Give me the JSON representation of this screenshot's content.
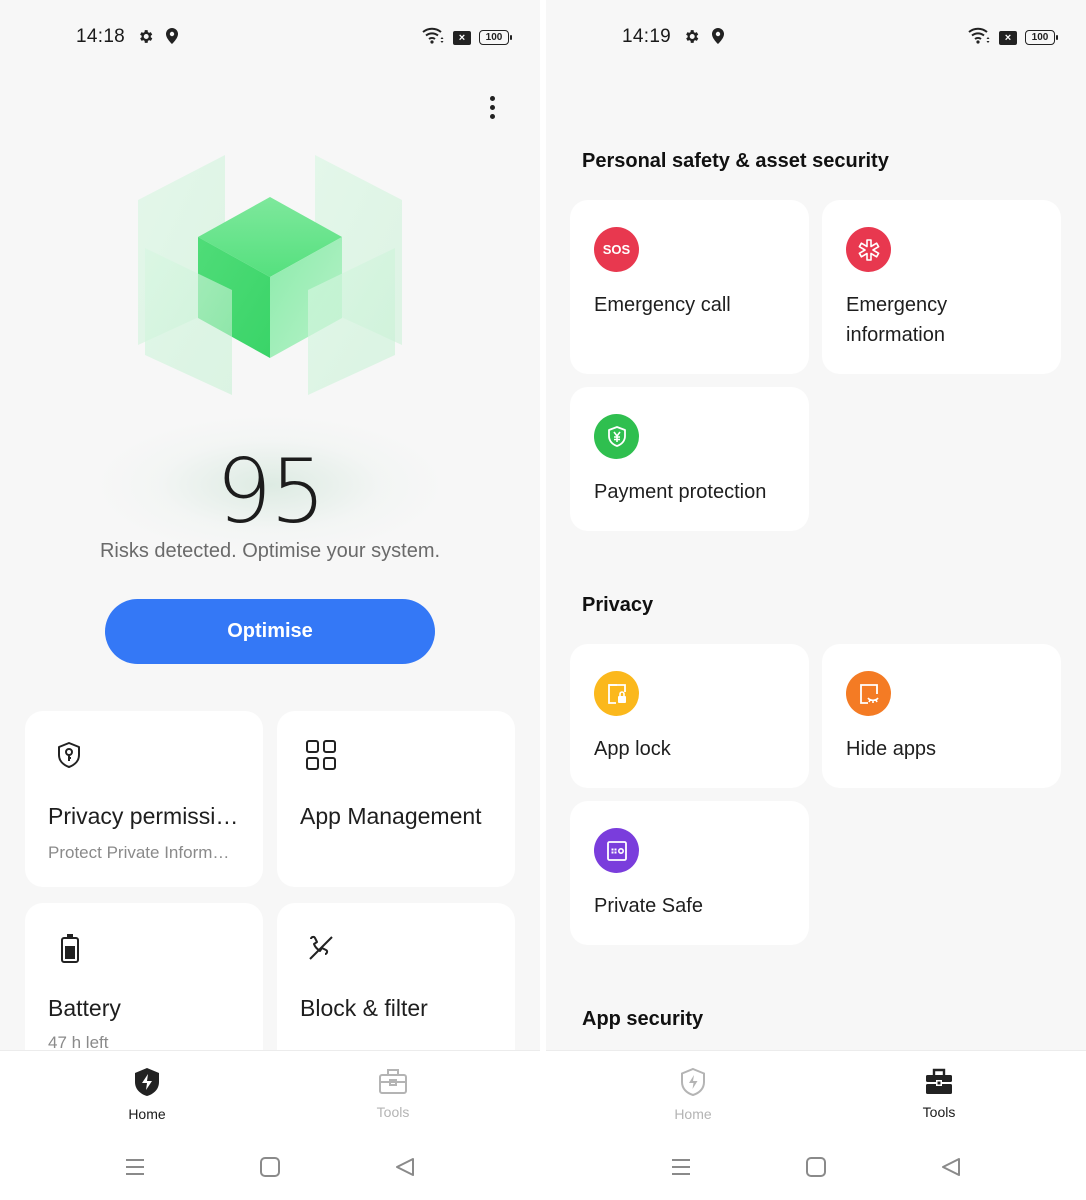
{
  "left_screen": {
    "status_bar": {
      "time": "14:18",
      "icons": [
        "settings-gear-icon",
        "location-pin-icon"
      ],
      "right_icons": [
        "wifi-icon",
        "sim-disabled-icon",
        "battery-icon"
      ],
      "sim_glyph": "×",
      "battery_level": "100"
    },
    "more_menu_icon": "more-vertical-icon",
    "hero_graphic": "green-security-cube-illustration",
    "score": "95",
    "risk_message": "Risks detected. Optimise your system.",
    "optimise_button": "Optimise",
    "cards": [
      {
        "title": "Privacy permissi…",
        "subtitle": "Protect Private Inform…",
        "icon": "shield-key-icon"
      },
      {
        "title": "App Management",
        "subtitle": "",
        "icon": "grid-apps-icon"
      },
      {
        "title": "Battery",
        "subtitle": "47 h left",
        "icon": "battery-icon"
      },
      {
        "title": "Block & filter",
        "subtitle": "",
        "icon": "blocked-call-icon"
      }
    ],
    "bottom_nav": {
      "tabs": [
        {
          "label": "Home",
          "icon": "shield-bolt-icon",
          "active": true
        },
        {
          "label": "Tools",
          "icon": "toolbox-icon",
          "active": false
        }
      ]
    },
    "system_nav": [
      "menu-icon",
      "home-square-icon",
      "back-triangle-icon"
    ]
  },
  "right_screen": {
    "status_bar": {
      "time": "14:19",
      "icons": [
        "settings-gear-icon",
        "location-pin-icon"
      ],
      "right_icons": [
        "wifi-icon",
        "sim-disabled-icon",
        "battery-icon"
      ],
      "sim_glyph": "×",
      "battery_level": "100"
    },
    "sections": [
      {
        "title": "Personal safety & asset security",
        "items": [
          {
            "title": "Emergency call",
            "icon": "sos-icon",
            "icon_text": "SOS",
            "color": "#e8384f"
          },
          {
            "title": "Emergency information",
            "icon": "medical-asterisk-icon",
            "color": "#e8384f"
          },
          {
            "title": "Payment protection",
            "icon": "yen-shield-icon",
            "color": "#2fbf4f"
          }
        ]
      },
      {
        "title": "Privacy",
        "items": [
          {
            "title": "App lock",
            "icon": "app-lock-icon",
            "color": "#fbb81c"
          },
          {
            "title": "Hide apps",
            "icon": "hide-apps-icon",
            "color": "#f47b24"
          },
          {
            "title": "Private Safe",
            "icon": "safe-vault-icon",
            "color": "#7a3ddc"
          }
        ]
      },
      {
        "title": "App security",
        "items": []
      }
    ],
    "bottom_nav": {
      "tabs": [
        {
          "label": "Home",
          "icon": "shield-bolt-icon",
          "active": false
        },
        {
          "label": "Tools",
          "icon": "toolbox-icon",
          "active": true
        }
      ]
    },
    "system_nav": [
      "menu-icon",
      "home-square-icon",
      "back-triangle-icon"
    ]
  },
  "colors": {
    "accent_blue": "#3478f6",
    "background": "#f7f7f7",
    "card": "#ffffff",
    "hero_green": "#3ddc6a"
  }
}
